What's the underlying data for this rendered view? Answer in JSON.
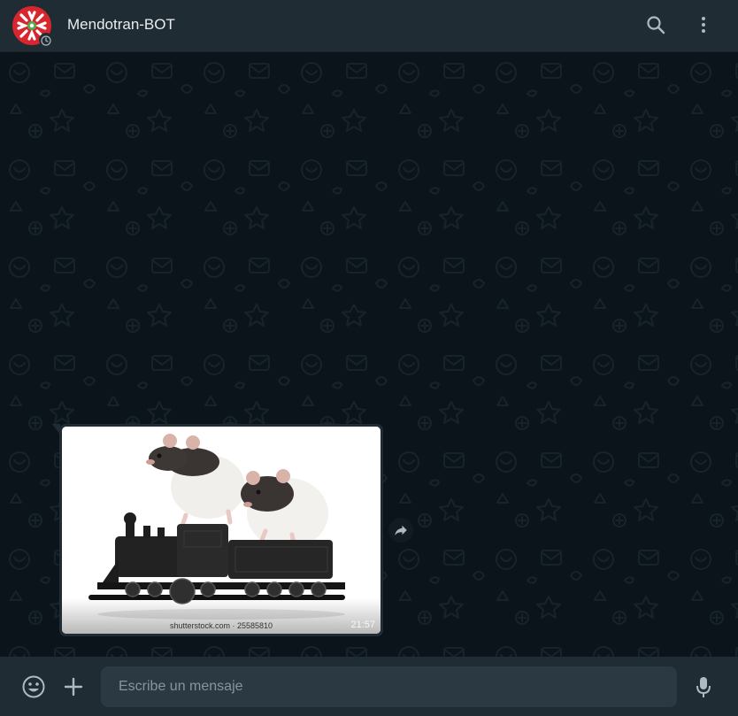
{
  "header": {
    "chat_name": "Mendotran-BOT"
  },
  "message": {
    "image": {
      "description": "",
      "watermark": "shutterstock.com · 25585810"
    },
    "time": "21:57"
  },
  "composer": {
    "placeholder": "Escribe un mensaje"
  },
  "colors": {
    "header_bg": "#202c33",
    "chat_bg": "#0b141a",
    "bubble_bg": "#202c33",
    "input_bg": "#2a3942",
    "icon": "#aebac1",
    "avatar_red": "#d8262e"
  },
  "icons": {
    "search": "search-icon",
    "menu": "kebab-menu-icon",
    "forward": "forward-icon",
    "emoji": "emoji-icon",
    "attach": "plus-icon",
    "mic": "microphone-icon"
  }
}
